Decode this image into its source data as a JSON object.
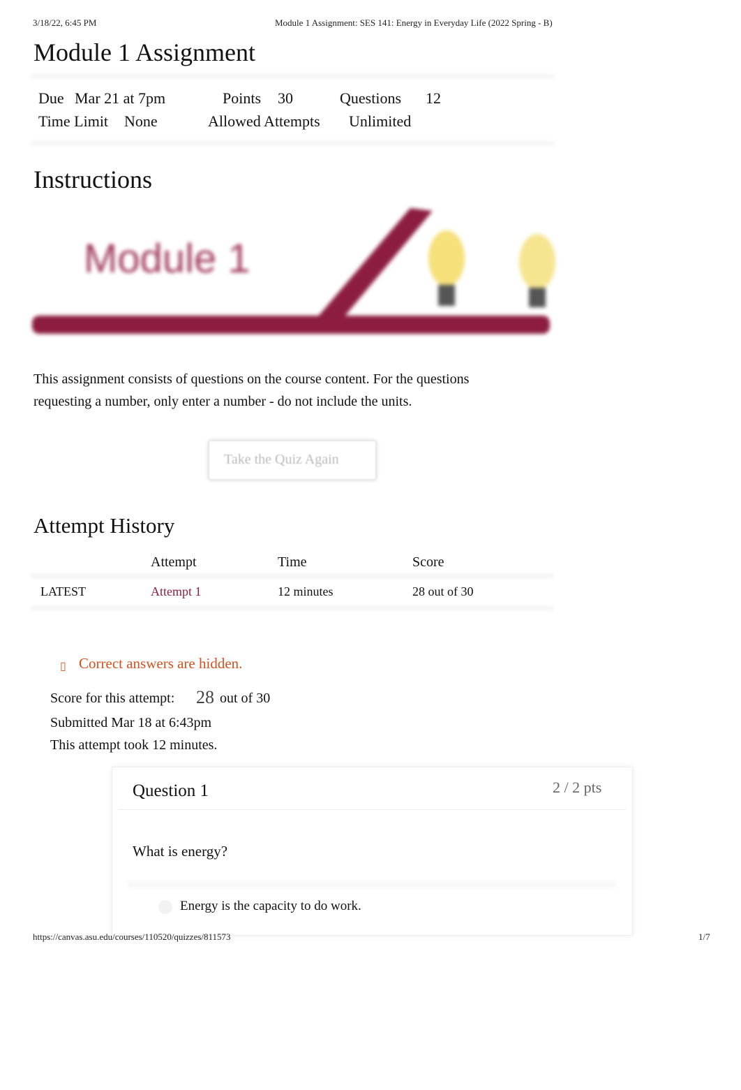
{
  "print_header": {
    "datetime": "3/18/22, 6:45 PM",
    "title": "Module 1 Assignment: SES 141: Energy in Everyday Life (2022 Spring - B)"
  },
  "page_title": "Module 1 Assignment",
  "details": {
    "due_label": "Due",
    "due_value": "Mar 21 at 7pm",
    "points_label": "Points",
    "points_value": "30",
    "questions_label": "Questions",
    "questions_value": "12",
    "time_limit_label": "Time Limit",
    "time_limit_value": "None",
    "attempts_label": "Allowed Attempts",
    "attempts_value": "Unlimited"
  },
  "instructions": {
    "heading": "Instructions",
    "banner_text": "Module 1",
    "banner_colors": {
      "maroon": "#8c1d40",
      "bulb": "#f5d75a"
    },
    "paragraph_line1": "This assignment consists of questions on the course content. For the questions",
    "paragraph_line2": "requesting a number, only enter a number - do not include the units."
  },
  "take_quiz_button": "Take the Quiz Again",
  "attempt_history": {
    "heading": "Attempt History",
    "columns": [
      "",
      "Attempt",
      "Time",
      "Score"
    ],
    "rows": [
      {
        "tag": "LATEST",
        "attempt": "Attempt 1",
        "time": "12 minutes",
        "score": "28 out of 30"
      }
    ]
  },
  "notice": {
    "icon": "info-icon",
    "text": "Correct answers are hidden.",
    "color": "#d4511f"
  },
  "score": {
    "label": "Score for this attempt:",
    "value": "28",
    "suffix": "out of 30"
  },
  "submitted": "Submitted Mar 18 at 6:43pm",
  "duration": "This attempt took 12 minutes.",
  "question": {
    "title": "Question 1",
    "points": "2 / 2 pts",
    "prompt": "What is energy?",
    "answer": "Energy is the capacity to do work."
  },
  "print_footer": {
    "url": "https://canvas.asu.edu/courses/110520/quizzes/811573",
    "page": "1/7"
  }
}
